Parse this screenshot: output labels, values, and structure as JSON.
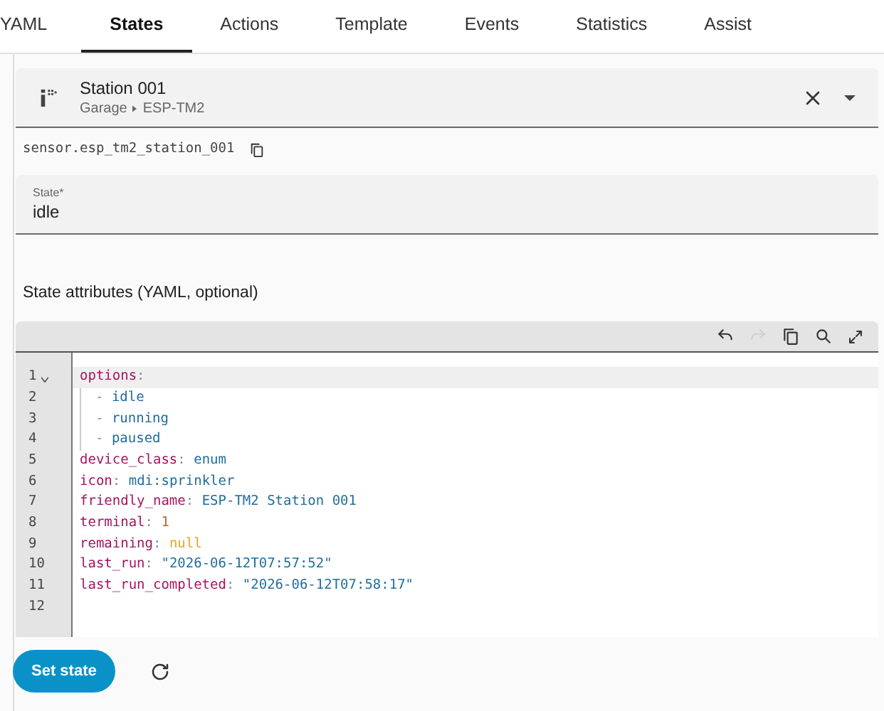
{
  "tabs": [
    {
      "label": "YAML",
      "selected": false
    },
    {
      "label": "States",
      "selected": true
    },
    {
      "label": "Actions",
      "selected": false
    },
    {
      "label": "Template",
      "selected": false
    },
    {
      "label": "Events",
      "selected": false
    },
    {
      "label": "Statistics",
      "selected": false
    },
    {
      "label": "Assist",
      "selected": false
    }
  ],
  "entity_picker": {
    "name": "Station 001",
    "area": "Garage",
    "device": "ESP-TM2"
  },
  "entity_id": "sensor.esp_tm2_station_001",
  "state_field": {
    "label": "State*",
    "value": "idle"
  },
  "attributes_label": "State attributes (YAML, optional)",
  "editor": {
    "redo_disabled": true,
    "lines": [
      {
        "number": "1",
        "foldable": true,
        "active": true,
        "indented": false,
        "tokens": [
          {
            "kind": "key",
            "text": "options"
          },
          {
            "kind": "punct",
            "text": ":"
          }
        ]
      },
      {
        "number": "2",
        "foldable": false,
        "active": false,
        "indented": true,
        "tokens": [
          {
            "kind": "punct",
            "text": "- "
          },
          {
            "kind": "value",
            "text": "idle"
          }
        ]
      },
      {
        "number": "3",
        "foldable": false,
        "active": false,
        "indented": true,
        "tokens": [
          {
            "kind": "punct",
            "text": "- "
          },
          {
            "kind": "value",
            "text": "running"
          }
        ]
      },
      {
        "number": "4",
        "foldable": false,
        "active": false,
        "indented": true,
        "tokens": [
          {
            "kind": "punct",
            "text": "- "
          },
          {
            "kind": "value",
            "text": "paused"
          }
        ]
      },
      {
        "number": "5",
        "foldable": false,
        "active": false,
        "indented": false,
        "tokens": [
          {
            "kind": "key",
            "text": "device_class"
          },
          {
            "kind": "punct",
            "text": ": "
          },
          {
            "kind": "value",
            "text": "enum"
          }
        ]
      },
      {
        "number": "6",
        "foldable": false,
        "active": false,
        "indented": false,
        "tokens": [
          {
            "kind": "key",
            "text": "icon"
          },
          {
            "kind": "punct",
            "text": ": "
          },
          {
            "kind": "value",
            "text": "mdi:sprinkler"
          }
        ]
      },
      {
        "number": "7",
        "foldable": false,
        "active": false,
        "indented": false,
        "tokens": [
          {
            "kind": "key",
            "text": "friendly_name"
          },
          {
            "kind": "punct",
            "text": ": "
          },
          {
            "kind": "value",
            "text": "ESP-TM2 Station 001"
          }
        ]
      },
      {
        "number": "8",
        "foldable": false,
        "active": false,
        "indented": false,
        "tokens": [
          {
            "kind": "key",
            "text": "terminal"
          },
          {
            "kind": "punct",
            "text": ": "
          },
          {
            "kind": "number",
            "text": "1"
          }
        ]
      },
      {
        "number": "9",
        "foldable": false,
        "active": false,
        "indented": false,
        "tokens": [
          {
            "kind": "key",
            "text": "remaining"
          },
          {
            "kind": "punct",
            "text": ": "
          },
          {
            "kind": "null",
            "text": "null"
          }
        ]
      },
      {
        "number": "10",
        "foldable": false,
        "active": false,
        "indented": false,
        "tokens": [
          {
            "kind": "key",
            "text": "last_run"
          },
          {
            "kind": "punct",
            "text": ": "
          },
          {
            "kind": "value",
            "text": "\"2026-06-12T07:57:52\""
          }
        ]
      },
      {
        "number": "11",
        "foldable": false,
        "active": false,
        "indented": false,
        "tokens": [
          {
            "kind": "key",
            "text": "last_run_completed"
          },
          {
            "kind": "punct",
            "text": ": "
          },
          {
            "kind": "value",
            "text": "\"2026-06-12T07:58:17\""
          }
        ]
      },
      {
        "number": "12",
        "foldable": false,
        "active": false,
        "indented": false
      }
    ]
  },
  "set_state_button": "Set state"
}
